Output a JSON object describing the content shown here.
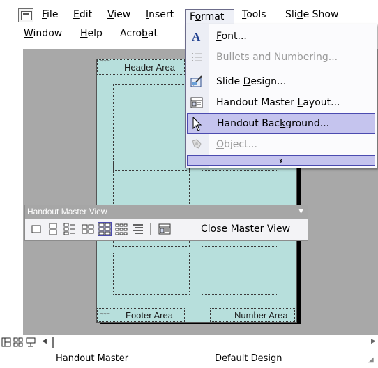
{
  "menubar": {
    "row1": [
      {
        "label": "File",
        "underline": "F",
        "rest": "ile"
      },
      {
        "label": "Edit",
        "underline": "E",
        "rest": "dit"
      },
      {
        "label": "View",
        "underline": "V",
        "rest": "iew"
      },
      {
        "label": "Insert",
        "underline": "I",
        "rest": "nsert"
      },
      {
        "label": "Format",
        "pre": "F",
        "underline": "o",
        "rest": "rmat"
      },
      {
        "label": "Tools",
        "underline": "T",
        "rest": "ools"
      },
      {
        "label": "Slide Show",
        "pre": "Sli",
        "underline": "d",
        "rest": "e Show"
      }
    ],
    "row2": [
      {
        "label": "Window",
        "underline": "W",
        "rest": "indow"
      },
      {
        "label": "Help",
        "underline": "H",
        "rest": "elp"
      },
      {
        "label": "Acrobat",
        "pre": "Acro",
        "underline": "b",
        "rest": "at"
      }
    ]
  },
  "format_menu": {
    "items": [
      {
        "pre": "",
        "u": "F",
        "post": "ont...",
        "icon": "font-icon",
        "enabled": true
      },
      {
        "pre": "",
        "u": "B",
        "post": "ullets and Numbering...",
        "icon": "bullets-icon",
        "enabled": false
      },
      {
        "pre": "Slide ",
        "u": "D",
        "post": "esign...",
        "icon": "slide-design-icon",
        "enabled": true
      },
      {
        "pre": "Handout Master ",
        "u": "L",
        "post": "ayout...",
        "icon": "handout-layout-icon",
        "enabled": true
      },
      {
        "pre": "Handout Bac",
        "u": "k",
        "post": "ground...",
        "icon": "background-icon",
        "enabled": true,
        "highlighted": true
      },
      {
        "pre": "",
        "u": "O",
        "post": "bject...",
        "icon": "object-icon",
        "enabled": false
      }
    ],
    "expand_glyph": "»"
  },
  "page": {
    "header_label": "Header Area",
    "footer_label": "Footer Area",
    "number_label": "Number Area"
  },
  "handout_toolbar": {
    "title": "Handout Master View",
    "close": {
      "u": "C",
      "post": "lose Master View"
    },
    "selected_layout": "4-slides"
  },
  "status": {
    "left": "Handout Master",
    "right": "Default Design"
  },
  "colors": {
    "page": "#b7dfdc",
    "highlight": "#c5c4ee",
    "workspace": "#a8a8a8"
  }
}
